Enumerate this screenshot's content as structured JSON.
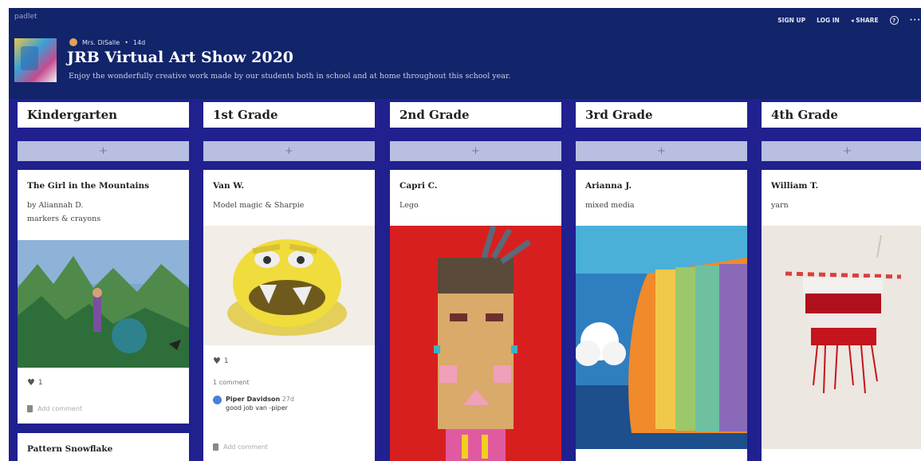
{
  "brand": "padlet",
  "header": {
    "author": "Mrs. DiSalle",
    "age": "14d",
    "title": "JRB Virtual Art Show 2020",
    "subtitle": "Enjoy the wonderfully creative work made by our students both in school and at home throughout this school year."
  },
  "topnav": {
    "signup": "SIGN UP",
    "login": "LOG IN",
    "share": "SHARE",
    "help": "?",
    "more": "···"
  },
  "colors": {
    "board_bg": "#20208f",
    "header_bg": "#12246a",
    "add_button": "#b8bfe0"
  },
  "columns": [
    {
      "title": "Kindergarten",
      "add": "+",
      "cards": [
        {
          "title": "The Girl in the Mountains",
          "line1": "by Aliannah D.",
          "line2": "markers & crayons",
          "likes": "1",
          "add_comment": "Add comment"
        },
        {
          "title": "Pattern Snowflake"
        }
      ]
    },
    {
      "title": "1st Grade",
      "add": "+",
      "cards": [
        {
          "title": "Van W.",
          "line1": "Model magic & Sharpie",
          "likes": "1",
          "comment_count": "1 comment",
          "comment_author": "Piper Davidson",
          "comment_time": "27d",
          "comment_text": "good job van -piper",
          "add_comment": "Add comment"
        }
      ]
    },
    {
      "title": "2nd Grade",
      "add": "+",
      "cards": [
        {
          "title": "Capri C.",
          "line1": "Lego"
        }
      ]
    },
    {
      "title": "3rd Grade",
      "add": "+",
      "cards": [
        {
          "title": "Arianna J.",
          "line1": "mixed media"
        }
      ]
    },
    {
      "title": "4th Grade",
      "add": "+",
      "cards": [
        {
          "title": "William T.",
          "line1": "yarn"
        }
      ]
    }
  ]
}
